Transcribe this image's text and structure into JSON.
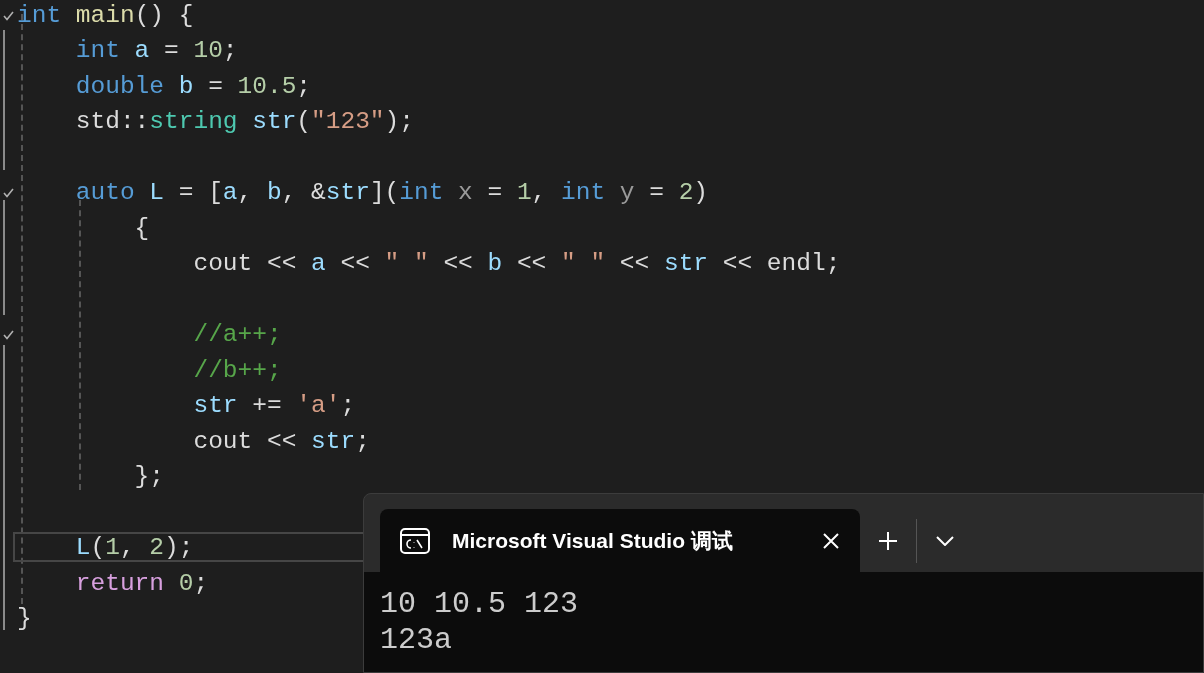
{
  "editor": {
    "lines": [
      {
        "kind": "code",
        "fold_mark": true,
        "current": false,
        "tokens": [
          {
            "kind": "keyword",
            "text": "int"
          },
          {
            "kind": "function",
            "text": " main"
          },
          {
            "kind": "plain",
            "text": "() {"
          }
        ]
      },
      {
        "kind": "code",
        "fold_mark": false,
        "current": false,
        "tokens": [
          {
            "kind": "keyword",
            "text": "    int"
          },
          {
            "kind": "variable",
            "text": " a"
          },
          {
            "kind": "plain",
            "text": " = "
          },
          {
            "kind": "number",
            "text": "10"
          },
          {
            "kind": "plain",
            "text": ";"
          }
        ]
      },
      {
        "kind": "code",
        "fold_mark": false,
        "current": false,
        "tokens": [
          {
            "kind": "keyword",
            "text": "    double"
          },
          {
            "kind": "variable",
            "text": " b"
          },
          {
            "kind": "plain",
            "text": " = "
          },
          {
            "kind": "number",
            "text": "10.5"
          },
          {
            "kind": "plain",
            "text": ";"
          }
        ]
      },
      {
        "kind": "code",
        "fold_mark": false,
        "current": false,
        "tokens": [
          {
            "kind": "plain",
            "text": "    std::"
          },
          {
            "kind": "type",
            "text": "string"
          },
          {
            "kind": "variable",
            "text": " str"
          },
          {
            "kind": "plain",
            "text": "("
          },
          {
            "kind": "string",
            "text": "\"123\""
          },
          {
            "kind": "plain",
            "text": ");"
          }
        ]
      },
      {
        "kind": "blank"
      },
      {
        "kind": "code",
        "fold_mark": true,
        "current": false,
        "tokens": [
          {
            "kind": "keyword",
            "text": "    auto"
          },
          {
            "kind": "variable",
            "text": " L"
          },
          {
            "kind": "plain",
            "text": " = ["
          },
          {
            "kind": "variable",
            "text": "a"
          },
          {
            "kind": "plain",
            "text": ", "
          },
          {
            "kind": "variable",
            "text": "b"
          },
          {
            "kind": "plain",
            "text": ", &"
          },
          {
            "kind": "variable",
            "text": "str"
          },
          {
            "kind": "plain",
            "text": "]("
          },
          {
            "kind": "keyword",
            "text": "int"
          },
          {
            "kind": "param",
            "text": " x"
          },
          {
            "kind": "plain",
            "text": " = "
          },
          {
            "kind": "number",
            "text": "1"
          },
          {
            "kind": "plain",
            "text": ", "
          },
          {
            "kind": "keyword",
            "text": "int"
          },
          {
            "kind": "param",
            "text": " y"
          },
          {
            "kind": "plain",
            "text": " = "
          },
          {
            "kind": "number",
            "text": "2"
          },
          {
            "kind": "plain",
            "text": ")"
          }
        ]
      },
      {
        "kind": "code",
        "fold_mark": false,
        "current": false,
        "tokens": [
          {
            "kind": "plain",
            "text": "        {"
          }
        ]
      },
      {
        "kind": "code",
        "fold_mark": false,
        "current": false,
        "tokens": [
          {
            "kind": "plain",
            "text": "            cout << "
          },
          {
            "kind": "variable",
            "text": "a"
          },
          {
            "kind": "plain",
            "text": " << "
          },
          {
            "kind": "string",
            "text": "\" \""
          },
          {
            "kind": "plain",
            "text": " << "
          },
          {
            "kind": "variable",
            "text": "b"
          },
          {
            "kind": "plain",
            "text": " << "
          },
          {
            "kind": "string",
            "text": "\" \""
          },
          {
            "kind": "plain",
            "text": " << "
          },
          {
            "kind": "variable",
            "text": "str"
          },
          {
            "kind": "plain",
            "text": " << endl;"
          }
        ]
      },
      {
        "kind": "blank"
      },
      {
        "kind": "code",
        "fold_mark": true,
        "current": false,
        "tokens": [
          {
            "kind": "comment",
            "text": "            //a++;"
          }
        ]
      },
      {
        "kind": "code",
        "fold_mark": false,
        "current": false,
        "tokens": [
          {
            "kind": "comment",
            "text": "            //b++;"
          }
        ]
      },
      {
        "kind": "code",
        "fold_mark": false,
        "current": false,
        "tokens": [
          {
            "kind": "variable",
            "text": "            str"
          },
          {
            "kind": "plain",
            "text": " += "
          },
          {
            "kind": "string",
            "text": "'a'"
          },
          {
            "kind": "plain",
            "text": ";"
          }
        ]
      },
      {
        "kind": "code",
        "fold_mark": false,
        "current": false,
        "tokens": [
          {
            "kind": "plain",
            "text": "            cout << "
          },
          {
            "kind": "variable",
            "text": "str"
          },
          {
            "kind": "plain",
            "text": ";"
          }
        ]
      },
      {
        "kind": "code",
        "fold_mark": false,
        "current": false,
        "tokens": [
          {
            "kind": "plain",
            "text": "        };"
          }
        ]
      },
      {
        "kind": "blank"
      },
      {
        "kind": "code",
        "fold_mark": false,
        "current": true,
        "tokens": [
          {
            "kind": "variable",
            "text": "    L"
          },
          {
            "kind": "plain",
            "text": "("
          },
          {
            "kind": "number",
            "text": "1"
          },
          {
            "kind": "plain",
            "text": ", "
          },
          {
            "kind": "number",
            "text": "2"
          },
          {
            "kind": "plain",
            "text": ");"
          }
        ]
      },
      {
        "kind": "code",
        "fold_mark": false,
        "current": false,
        "tokens": [
          {
            "kind": "control",
            "text": "    return"
          },
          {
            "kind": "number",
            "text": " 0"
          },
          {
            "kind": "plain",
            "text": ";"
          }
        ]
      },
      {
        "kind": "code",
        "fold_mark": false,
        "current": false,
        "tokens": [
          {
            "kind": "plain",
            "text": "}"
          }
        ]
      }
    ]
  },
  "console": {
    "tab_title": "Microsoft Visual Studio 调试",
    "output": [
      "10 10.5 123",
      "123a"
    ]
  }
}
